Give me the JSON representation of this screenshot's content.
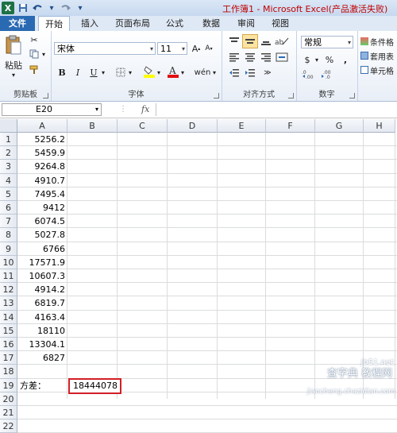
{
  "window": {
    "title": "工作簿1 - Microsoft Excel(产品激活失败)"
  },
  "qat": {
    "logo": "X",
    "save_icon": "save-icon",
    "undo_icon": "undo-icon",
    "redo_icon": "redo-icon"
  },
  "tabs": [
    {
      "label": "文件"
    },
    {
      "label": "开始"
    },
    {
      "label": "插入"
    },
    {
      "label": "页面布局"
    },
    {
      "label": "公式"
    },
    {
      "label": "数据"
    },
    {
      "label": "审阅"
    },
    {
      "label": "视图"
    }
  ],
  "ribbon": {
    "clipboard": {
      "paste_label": "粘贴",
      "group_label": "剪贴板"
    },
    "font": {
      "font_name": "宋体",
      "font_size": "11",
      "group_label": "字体",
      "bold": "B",
      "italic": "I",
      "underline": "U"
    },
    "alignment": {
      "group_label": "对齐方式"
    },
    "number": {
      "format": "常规",
      "group_label": "数字",
      "percent": "%",
      "comma": ",",
      "currency": "$"
    },
    "styles": {
      "item1": "条件格",
      "item2": "套用表",
      "item3": "单元格"
    }
  },
  "formula_bar": {
    "name_box": "E20",
    "fx": "fx",
    "content": ""
  },
  "columns": [
    "A",
    "B",
    "C",
    "D",
    "E",
    "F",
    "G",
    "H"
  ],
  "rows": [
    "1",
    "2",
    "3",
    "4",
    "5",
    "6",
    "7",
    "8",
    "9",
    "10",
    "11",
    "12",
    "13",
    "14",
    "15",
    "16",
    "17",
    "18",
    "19",
    "20",
    "21",
    "22"
  ],
  "column_a_values": [
    "5256.2",
    "5459.9",
    "9264.8",
    "4910.7",
    "7495.4",
    "9412",
    "6074.5",
    "5027.8",
    "6766",
    "17571.9",
    "10607.3",
    "4914.2",
    "6819.7",
    "4163.4",
    "18110",
    "13304.1",
    "6827"
  ],
  "variance": {
    "label": "方差：",
    "value": "18444078"
  },
  "watermark": {
    "line0": "jb51.net",
    "line1": "查字典 教程网",
    "line2": "jiaocheng.chazidian.com"
  }
}
